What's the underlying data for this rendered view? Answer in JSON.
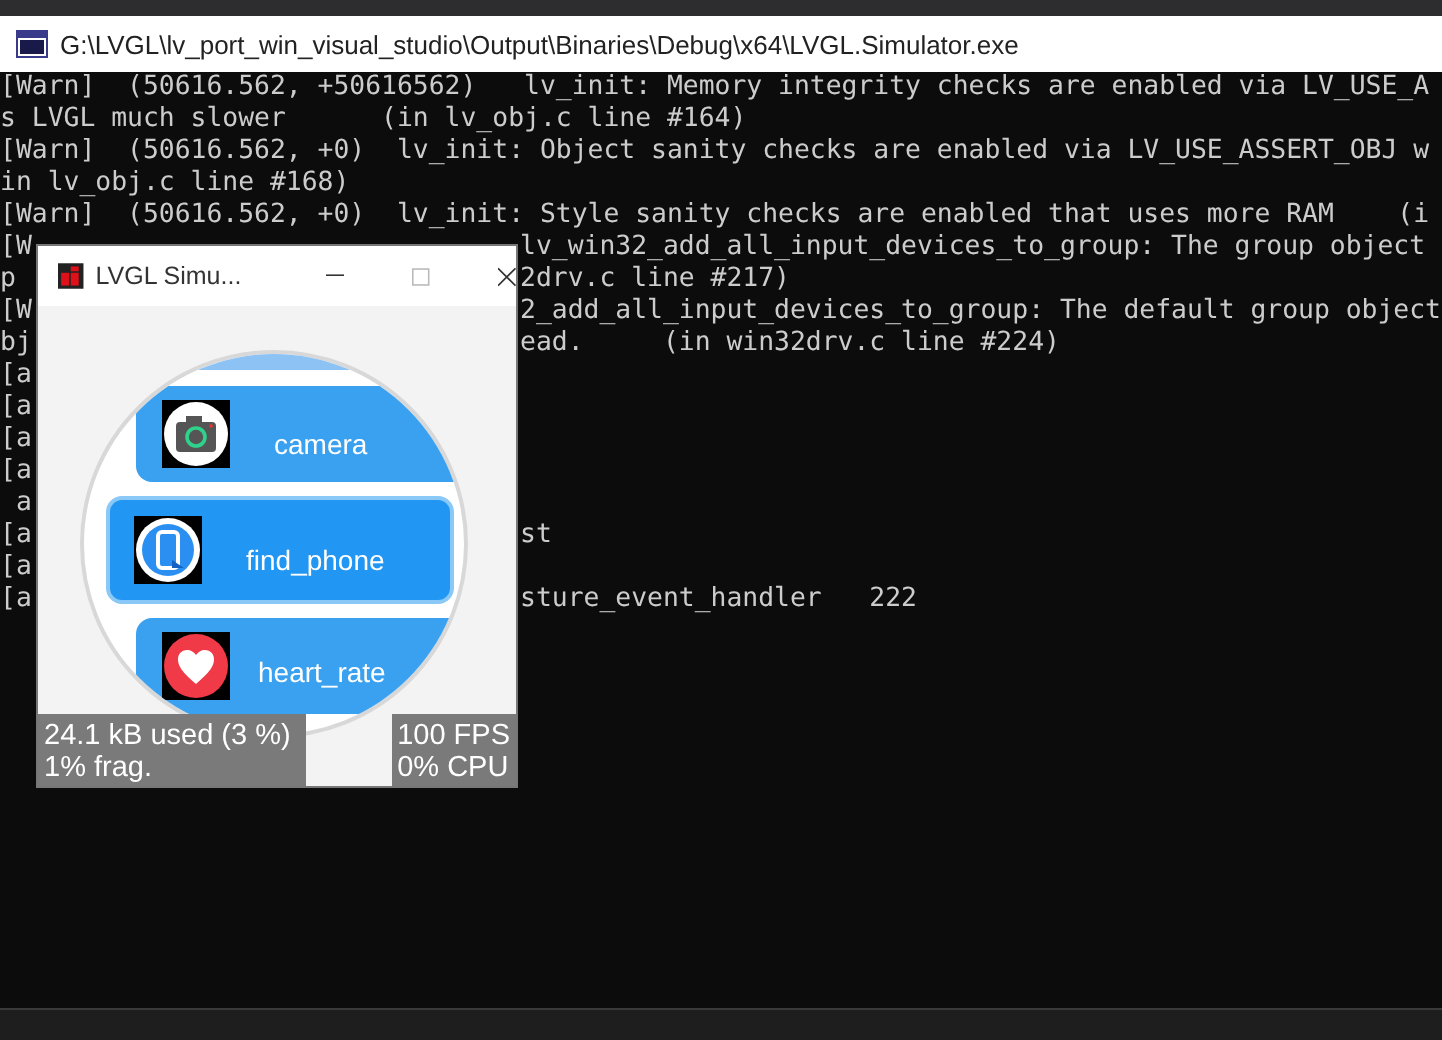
{
  "console": {
    "title": "G:\\LVGL\\lv_port_win_visual_studio\\Output\\Binaries\\Debug\\x64\\LVGL.Simulator.exe",
    "lines": [
      {
        "text": "[Warn]  (50616.562, +50616562)   lv_init: Memory integrity checks are enabled via LV_USE_A"
      },
      {
        "text": "s LVGL much slower      (in lv_obj.c line #164)"
      },
      {
        "text": "[Warn]  (50616.562, +0)  lv_init: Object sanity checks are enabled via LV_USE_ASSERT_OBJ w"
      },
      {
        "text": "in lv_obj.c line #168)"
      },
      {
        "text": "[Warn]  (50616.562, +0)  lv_init: Style sanity checks are enabled that uses more RAM    (i"
      },
      {
        "left": "[W",
        "right": "lv_win32_add_all_input_devices_to_group: The group object"
      },
      {
        "left": "p",
        "right": "2drv.c line #217)"
      },
      {
        "left": "[W",
        "right": "2_add_all_input_devices_to_group: The default group object"
      },
      {
        "left": "bj",
        "right": "ead.     (in win32drv.c line #224)"
      },
      {
        "left": "[a"
      },
      {
        "left": "[a"
      },
      {
        "left": "[a"
      },
      {
        "left": "[a"
      },
      {
        "left": " a"
      },
      {
        "left": "[a",
        "right": "st"
      },
      {
        "left": "[a"
      },
      {
        "left": "[a",
        "right": "sture_event_handler   222"
      }
    ]
  },
  "simulator": {
    "title": "LVGL Simu...",
    "items": [
      {
        "name": "camera",
        "kind": "camera",
        "selected": false
      },
      {
        "name": "find_phone",
        "kind": "phone",
        "selected": true
      },
      {
        "name": "heart_rate",
        "kind": "heart",
        "selected": false
      }
    ],
    "memory": [
      "24.1 kB used (3 %)",
      "1% frag."
    ],
    "performance": [
      "100 FPS",
      "0% CPU"
    ]
  }
}
